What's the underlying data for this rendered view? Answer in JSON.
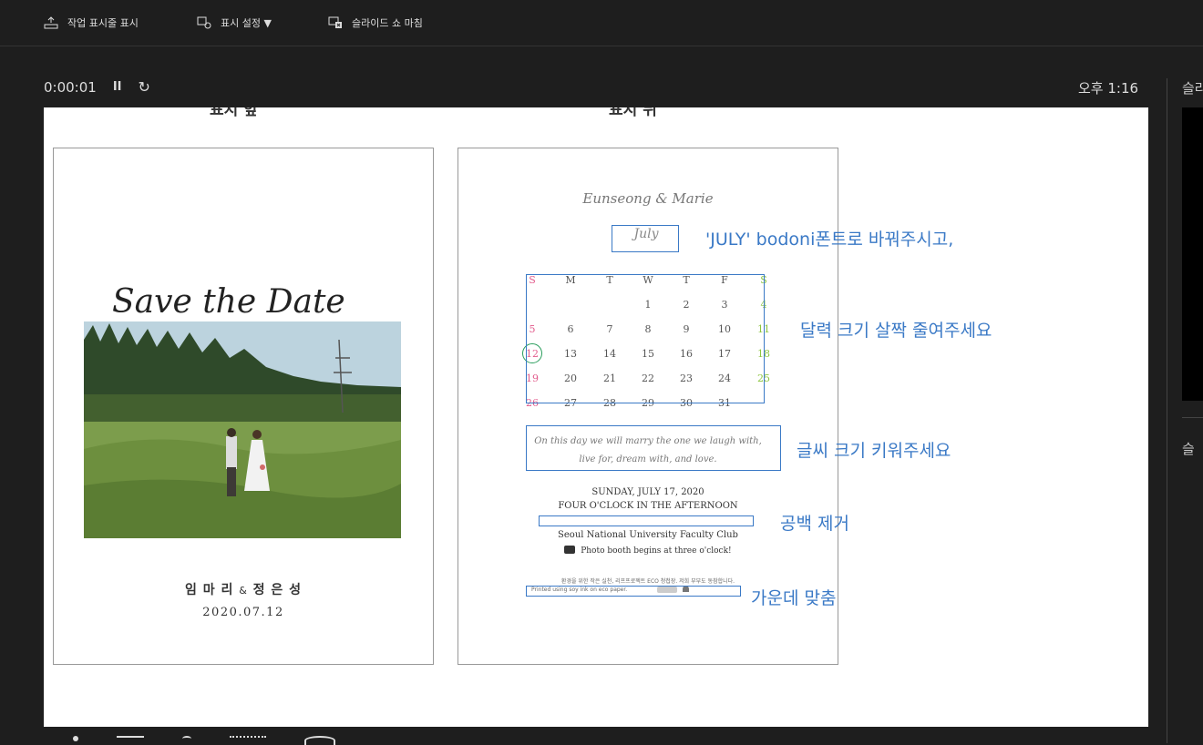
{
  "toolbar": {
    "items": [
      {
        "label": "작업 표시줄 표시",
        "icon": "taskbar-icon"
      },
      {
        "label": "표시 설정 ▼",
        "icon": "display-settings-icon"
      },
      {
        "label": "슬라이드 쇼 마침",
        "icon": "end-slideshow-icon"
      }
    ]
  },
  "presenter": {
    "timer": "0:00:01",
    "pause_icon": "pause-icon",
    "reset_icon": "reset-icon",
    "clock": "오후 1:16",
    "next_label": "슬라",
    "notes_label": "슬"
  },
  "slide": {
    "front_title": "표지 앞",
    "back_title": "표지 뒤",
    "front": {
      "script_title": "Save the Date",
      "names_a": "임 마 리",
      "amp": "&",
      "names_b": "정 은 성",
      "date": "2020.07.12"
    },
    "back": {
      "couple": "Eunseong & Marie",
      "month": "July",
      "weekdays": [
        "S",
        "M",
        "T",
        "W",
        "T",
        "F",
        "S"
      ],
      "weeks": [
        [
          "",
          "",
          "",
          "1",
          "2",
          "3",
          "4"
        ],
        [
          "5",
          "6",
          "7",
          "8",
          "9",
          "10",
          "11"
        ],
        [
          "12",
          "13",
          "14",
          "15",
          "16",
          "17",
          "18"
        ],
        [
          "19",
          "20",
          "21",
          "22",
          "23",
          "24",
          "25"
        ],
        [
          "26",
          "27",
          "28",
          "29",
          "30",
          "31",
          ""
        ]
      ],
      "verse_line1": "On this day we will marry the one we laugh with,",
      "verse_line2": "live for, dream with, and love.",
      "event_date": "SUNDAY, JULY 17, 2020",
      "event_time": "FOUR O'CLOCK IN THE AFTERNOON",
      "venue": "Seoul National University Faculty Club",
      "photo_booth": "Photo booth begins at three o'clock!",
      "eco_korean": "환경을 위한 작은 실천, 리프프로젝트 ECO 청첩장. 저희 부부도 동참합니다.",
      "eco_english": "Printed using soy ink on eco paper."
    },
    "notes": [
      "'JULY' bodoni폰트로 바꿔주시고,",
      "달력 크기 살짝 줄여주세요",
      "글씨 크기 키워주세요",
      "공백 제거",
      "가운데 맞춤"
    ]
  },
  "colors": {
    "note": "#3a79c6",
    "sunday": "#e25b8c",
    "saturday": "#8cc63e",
    "highlight": "#2a9d5c"
  }
}
